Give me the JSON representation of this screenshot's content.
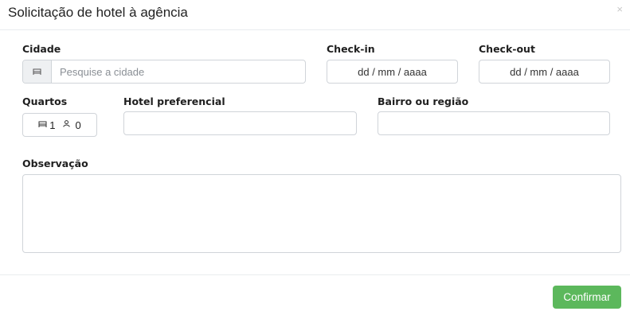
{
  "modal": {
    "title": "Solicitação de hotel à agência",
    "close_glyph": "×"
  },
  "form": {
    "city": {
      "label": "Cidade",
      "placeholder": "Pesquise a cidade",
      "value": ""
    },
    "checkin": {
      "label": "Check-in",
      "value": "dd / mm / aaaa"
    },
    "checkout": {
      "label": "Check-out",
      "value": "dd / mm / aaaa"
    },
    "rooms": {
      "label": "Quartos",
      "rooms_count": "1",
      "guests_count": "0"
    },
    "hotel": {
      "label": "Hotel preferencial",
      "value": ""
    },
    "neighborhood": {
      "label": "Bairro ou região",
      "value": ""
    },
    "notes": {
      "label": "Observação",
      "value": ""
    }
  },
  "footer": {
    "confirm_label": "Confirmar"
  },
  "icons": {
    "city_addon": "bed-icon",
    "rooms": "bed-icon",
    "guests": "person-icon"
  },
  "colors": {
    "confirm_button": "#5cb85c",
    "addon_bg": "#eef0f2",
    "border": "#d0d4d9"
  }
}
